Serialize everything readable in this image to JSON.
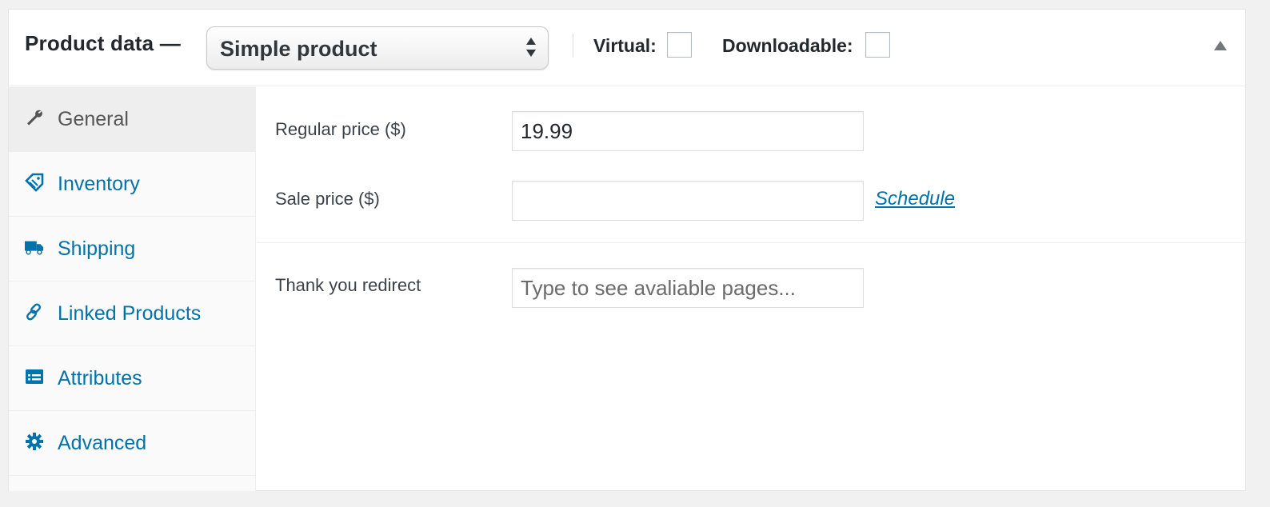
{
  "header": {
    "title": "Product data —",
    "product_type": {
      "selected": "Simple product",
      "icon": "select-arrows-icon"
    },
    "virtual_label": "Virtual:",
    "virtual_checked": false,
    "downloadable_label": "Downloadable:",
    "downloadable_checked": false,
    "toggle_icon": "triangle-up-icon"
  },
  "tabs": [
    {
      "label": "General",
      "icon": "wrench-icon",
      "active": true
    },
    {
      "label": "Inventory",
      "icon": "tag-icon",
      "active": false
    },
    {
      "label": "Shipping",
      "icon": "truck-icon",
      "active": false
    },
    {
      "label": "Linked Products",
      "icon": "link-icon",
      "active": false
    },
    {
      "label": "Attributes",
      "icon": "list-icon",
      "active": false
    },
    {
      "label": "Advanced",
      "icon": "gear-icon",
      "active": false
    }
  ],
  "fields": {
    "regular_price": {
      "label": "Regular price ($)",
      "value": "19.99"
    },
    "sale_price": {
      "label": "Sale price ($)",
      "value": "",
      "schedule_link": "Schedule"
    },
    "thank_you_redirect": {
      "label": "Thank you redirect",
      "value": "",
      "placeholder": "Type to see avaliable pages..."
    }
  },
  "colors": {
    "link": "#0073aa",
    "active_tab_bg": "#eeeeee",
    "tabs_bg": "#fafafa",
    "page_bg": "#f1f1f1"
  }
}
